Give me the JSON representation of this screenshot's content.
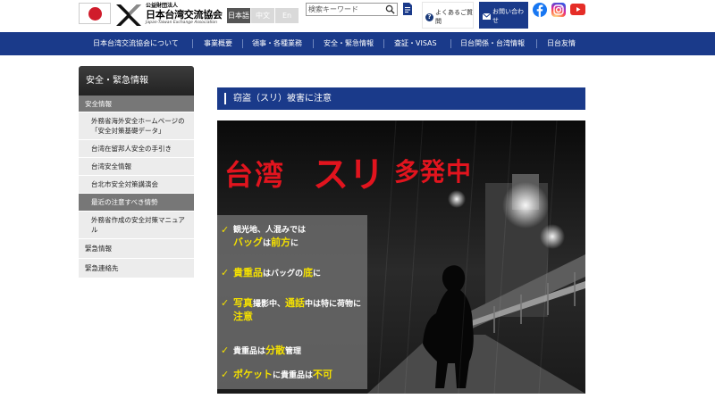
{
  "header": {
    "logo": {
      "sub": "公益財団法人",
      "main": "日本台湾交流協会",
      "en": "Japan-Taiwan Exchange Association"
    },
    "languages": [
      "日本語",
      "中文",
      "En"
    ],
    "search": {
      "placeholder": "検索キーワード"
    },
    "faq_label": "よくあるご質問",
    "contact_label": "お問い合わせ",
    "sns": [
      "facebook-icon",
      "instagram-icon",
      "youtube-icon"
    ]
  },
  "nav": {
    "items": [
      "日本台湾交流協会について",
      "事業概要",
      "領事・各種業務",
      "安全・緊急情報",
      "査証・VISAS",
      "日台関係・台湾情報",
      "日台友情"
    ]
  },
  "sidebar": {
    "heading": "安全・緊急情報",
    "group1": "安全情報",
    "sub_items": [
      "外務省海外安全ホームページの「安全対策基礎データ」",
      "台湾在留邦人安全の手引き",
      "台湾安全情報",
      "台北市安全対策講演会"
    ],
    "current": "最近の注意すべき情勢",
    "after_current": "外務省作成の安全対策マニュアル",
    "cats": [
      "緊急情報",
      "緊急連絡先"
    ]
  },
  "main": {
    "title": "窃盗（スリ）被害に注意",
    "poster": {
      "headline": [
        "台湾",
        "スリ",
        "多発中"
      ],
      "tips": [
        {
          "a": "観光地、人混みでは",
          "hl": "バッグ",
          "b": "は",
          "hl2": "前方",
          "c": "に"
        },
        {
          "hl": "貴重品",
          "b": "はバッグの",
          "hl2": "底",
          "c": "に"
        },
        {
          "hl": "写真",
          "b": "撮影中、",
          "hl2": "通話",
          "c": "中は特に荷物に",
          "hl3": "注意"
        },
        {
          "a": "貴重品は",
          "hl": "分散",
          "b": "管理"
        },
        {
          "hl": "ポケット",
          "b": "に貴重品は",
          "hl2": "不可"
        }
      ]
    }
  },
  "colors": {
    "brand": "#1a3a8a",
    "alert": "#e1141e",
    "highlight": "#f4e000"
  }
}
